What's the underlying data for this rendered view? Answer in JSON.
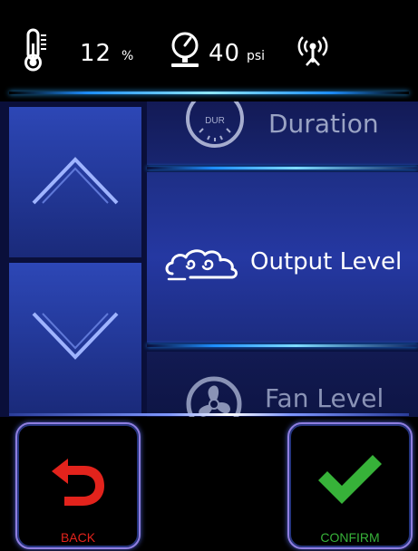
{
  "status": {
    "humidity_value": "12",
    "humidity_unit": "%",
    "pressure_value": "40",
    "pressure_unit": "psi",
    "icons": [
      "thermometer-icon",
      "pressure-gauge-icon",
      "wireless-antenna-icon"
    ]
  },
  "menu": {
    "prev": {
      "label": "Duration",
      "icon": "duration-dial-icon",
      "icon_text": "DUR"
    },
    "current": {
      "label": "Output Level",
      "icon": "cloud-output-icon"
    },
    "next": {
      "label": "Fan Level",
      "icon": "fan-icon"
    }
  },
  "nav": {
    "up_icon": "chevron-up-icon",
    "down_icon": "chevron-down-icon"
  },
  "footer": {
    "back_label": "BACK",
    "confirm_label": "CONFIRM"
  },
  "colors": {
    "background": "#000000",
    "panel": "#0a0f3a",
    "selected": "#2538a2",
    "accent_glow": "#1e8fff",
    "back": "#e2231c",
    "confirm": "#37b239"
  }
}
